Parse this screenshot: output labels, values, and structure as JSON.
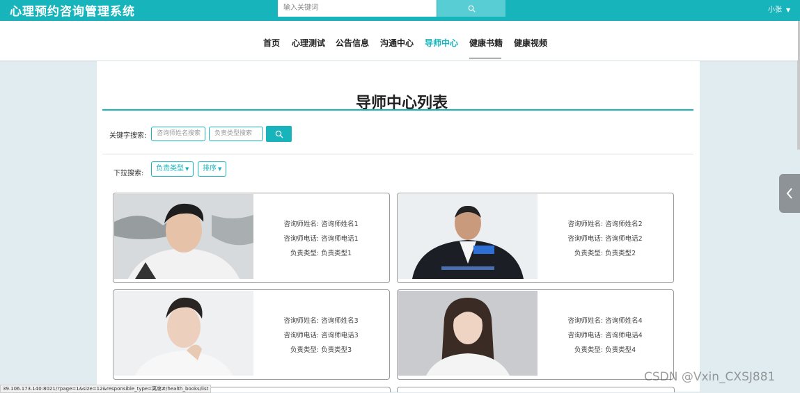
{
  "header": {
    "app_title": "心理预约咨询管理系统",
    "search_placeholder": "输入关键词",
    "search_icon": "search-icon",
    "user_name": "小张",
    "user_caret": "▼"
  },
  "nav": {
    "items": [
      "首页",
      "心理测试",
      "公告信息",
      "沟通中心",
      "导师中心",
      "健康书籍",
      "健康视频"
    ],
    "active": "导师中心"
  },
  "page": {
    "title": "导师中心列表",
    "keyword_label": "关键字搜索:",
    "name_placeholder": "咨询师姓名搜索",
    "type_placeholder": "负责类型搜索",
    "dropdown_label": "下拉搜索:",
    "dropdown_type": "负责类型",
    "dropdown_sort": "排序",
    "caret": "▼"
  },
  "cards": [
    {
      "name_label": "咨询师姓名:",
      "name": "咨询师姓名1",
      "phone_label": "咨询师电话:",
      "phone": "咨询师电话1",
      "type_label": "负责类型:",
      "type": "负责类型1"
    },
    {
      "name_label": "咨询师姓名:",
      "name": "咨询师姓名2",
      "phone_label": "咨询师电话:",
      "phone": "咨询师电话2",
      "type_label": "负责类型:",
      "type": "负责类型2"
    },
    {
      "name_label": "咨询师姓名:",
      "name": "咨询师姓名3",
      "phone_label": "咨询师电话:",
      "phone": "咨询师电话3",
      "type_label": "负责类型:",
      "type": "负责类型3"
    },
    {
      "name_label": "咨询师姓名:",
      "name": "咨询师姓名4",
      "phone_label": "咨询师电话:",
      "phone": "咨询师电话4",
      "type_label": "负责类型:",
      "type": "负责类型4"
    }
  ],
  "status_url": "39.106.173.140:8021/?page=1&size=12&responsible_type=离席#/health_books/list",
  "watermark": "CSDN @Vxin_CXSJ881",
  "colors": {
    "accent": "#17b4bc",
    "accent_light": "#58cdd3",
    "background": "#e0ecef"
  }
}
